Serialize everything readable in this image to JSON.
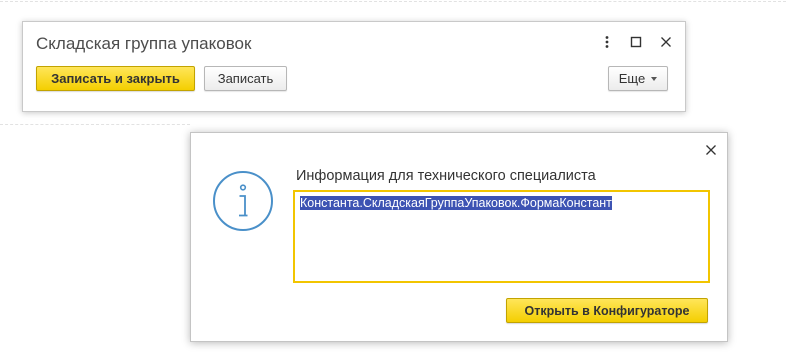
{
  "form": {
    "title": "Складская группа упаковок",
    "buttons": {
      "save_and_close": "Записать и закрыть",
      "save": "Записать",
      "more": "Еще"
    },
    "window_controls": [
      "more-actions-icon",
      "maximize-icon",
      "close-icon"
    ]
  },
  "info_dialog": {
    "title": "Информация для технического специалиста",
    "field_value": "Константа.СкладскаяГруппаУпаковок.ФормаКонстант",
    "open_button": "Открыть в Конфигураторе",
    "icon": "info-icon"
  },
  "colors": {
    "accent_yellow": "#f4cf00",
    "selection_blue": "#3d53b3",
    "icon_blue": "#4a90c9"
  }
}
